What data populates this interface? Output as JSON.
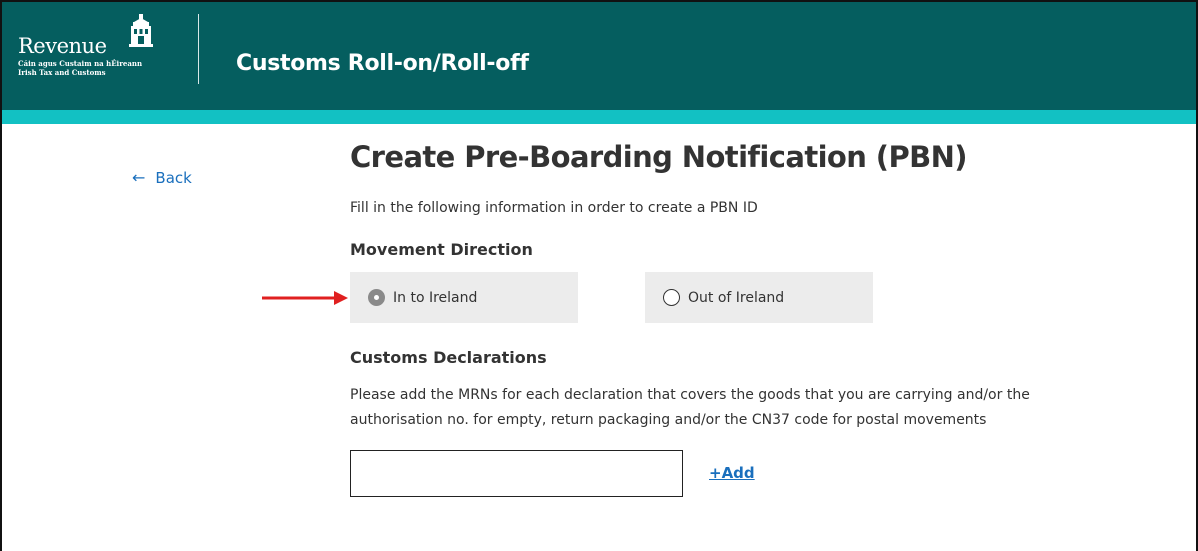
{
  "header": {
    "logo_word": "Revenue",
    "logo_sub_line1": "Cáin agus Custaim na hÉireann",
    "logo_sub_line2": "Irish Tax and Customs",
    "app_title": "Customs Roll-on/Roll-off",
    "background_color": "#055e5f",
    "accent_color": "#12c1c3"
  },
  "nav": {
    "back_label": "Back",
    "back_icon": "arrow-left-icon"
  },
  "page": {
    "title": "Create Pre-Boarding Notification (PBN)",
    "intro": "Fill in the following information in order to create a PBN ID"
  },
  "movement": {
    "label": "Movement Direction",
    "options": [
      {
        "label": "In to Ireland",
        "selected": true
      },
      {
        "label": "Out of Ireland",
        "selected": false
      }
    ]
  },
  "customs": {
    "label": "Customs Declarations",
    "help_line1": "Please add the MRNs for each declaration that covers the goods that you are carrying and/or the",
    "help_line2": "authorisation no. for empty, return packaging and/or the CN37 code for postal movements",
    "input_value": "",
    "add_label": "+Add"
  },
  "annotation": {
    "arrow_color": "#e02020"
  }
}
